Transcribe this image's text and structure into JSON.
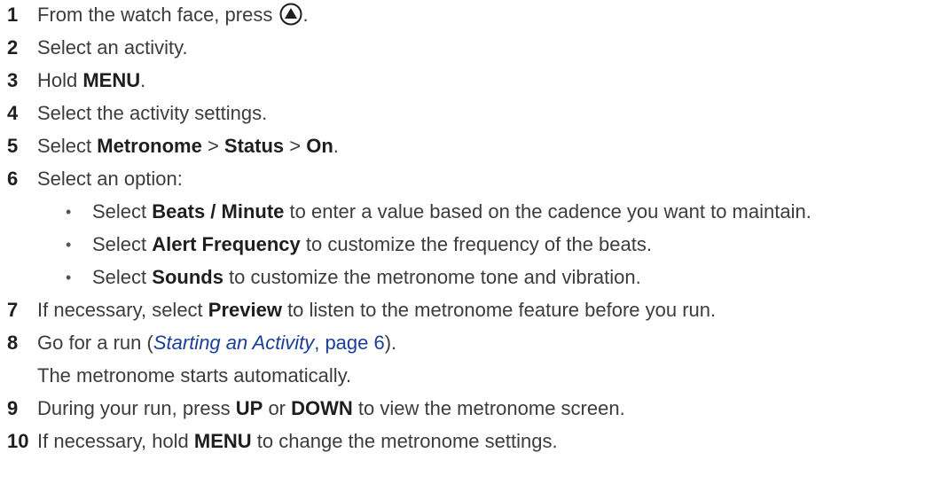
{
  "steps": [
    {
      "num": "1",
      "text": "From the watch face, press",
      "icon": "up-button-icon",
      "tail": "."
    },
    {
      "num": "2",
      "text": "Select an activity."
    },
    {
      "num": "3",
      "pre": "Hold ",
      "b1": "MENU",
      "post": "."
    },
    {
      "num": "4",
      "text": "Select the activity settings."
    },
    {
      "num": "5",
      "pre": "Select ",
      "b1": "Metronome",
      "s1": " > ",
      "b2": "Status",
      "s2": " > ",
      "b3": "On",
      "post": "."
    },
    {
      "num": "6",
      "text": "Select an option:",
      "bullets": [
        {
          "dot": "•",
          "pre": "Select ",
          "bold": "Beats / Minute",
          "post": " to enter a value based on the cadence you want to maintain."
        },
        {
          "dot": "•",
          "pre": "Select ",
          "bold": "Alert Frequency",
          "post": " to customize the frequency of the beats."
        },
        {
          "dot": "•",
          "pre": "Select ",
          "bold": "Sounds",
          "post": " to customize the metronome tone and vibration."
        }
      ]
    },
    {
      "num": "7",
      "pre": "If necessary, select ",
      "b1": "Preview",
      "post": " to listen to the metronome feature before you run."
    },
    {
      "num": "8",
      "pre": "Go for a run (",
      "link_italic": "Starting an Activity",
      "link_rest": ", page 6",
      "post": ").",
      "continuation": "The metronome starts automatically."
    },
    {
      "num": "9",
      "pre": "During your run, press ",
      "b1": "UP",
      "s1": " or ",
      "b2": "DOWN",
      "post": " to view the metronome screen."
    },
    {
      "num": "10",
      "pre": "If necessary, hold ",
      "b1": "MENU",
      "post": " to change the metronome settings."
    }
  ]
}
